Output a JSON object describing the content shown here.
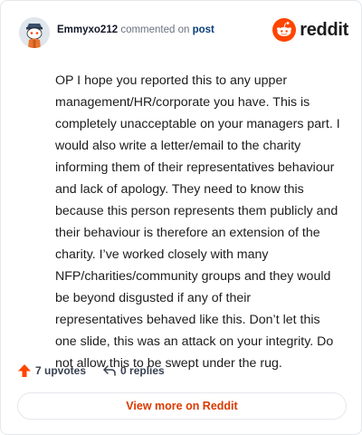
{
  "header": {
    "username": "Emmyxo212",
    "action_text": "commented on",
    "post_link": "post",
    "logo_text": "reddit"
  },
  "comment": {
    "body": "OP I hope you reported this to any upper management/HR/corporate you have. This is completely unacceptable on your managers part. I would also write a letter/email to the charity informing them of their representatives behaviour and lack of apology. They need to know this because this person represents them publicly and their behaviour is therefore an extension of the charity. I’ve worked closely with many NFP/charities/community groups and they would be beyond disgusted if any of their representatives behaved like this. Don’t let this one slide, this was an attack on your integrity. Do not allow this to be swept under the rug."
  },
  "actions": {
    "upvotes": "7 upvotes",
    "replies": "0 replies"
  },
  "footer": {
    "view_more": "View more on Reddit"
  },
  "colors": {
    "brand": "#ff4500",
    "upvote": "#ff4500",
    "link": "#d93a00"
  },
  "icons": {
    "avatar": "snoo-avatar",
    "logo": "reddit-snoo-icon",
    "upvote": "upvote-arrow-icon",
    "reply": "reply-arrow-icon"
  }
}
